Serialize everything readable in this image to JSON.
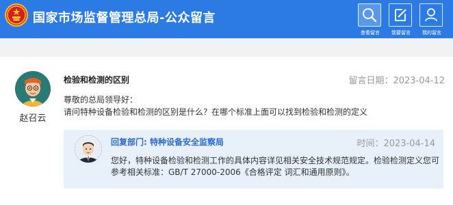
{
  "header": {
    "title": "国家市场监督管理总局-公众留言",
    "nav": [
      {
        "label": "查看留言",
        "icon": "search-icon"
      },
      {
        "label": "我要留言",
        "icon": "edit-icon"
      },
      {
        "label": "我的留言",
        "icon": "user-icon"
      }
    ]
  },
  "message": {
    "user_name": "赵召云",
    "title": "检验和检测的区别",
    "date": "留言日期：2023-04-12",
    "greeting": "尊敬的总局领导好：",
    "body": "请问特种设备检验和检测的区别是什么？在哪个标准上面可以找到检验和检测的定义"
  },
  "reply": {
    "department": "回复部门: 特种设备安全监察局",
    "date": "时间：2023-04-14",
    "body": "您好，特种设备检验和检测工作的具体内容详见相关安全技术规范规定。检验检测定义您可参考相关标准：GB/T 27000-2006《合格评定 词汇和通用原则》。"
  },
  "colors": {
    "header_bg": "#2c7be5",
    "reply_bg": "#e8f0fa",
    "dept_text": "#2c6bc9"
  }
}
